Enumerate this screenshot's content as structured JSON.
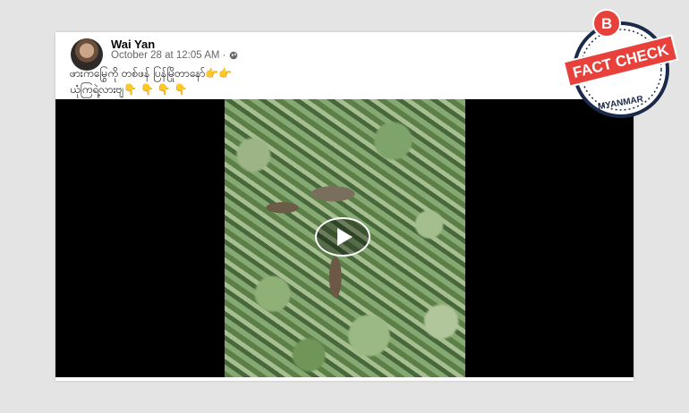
{
  "post": {
    "author": "Wai Yan",
    "timestamp": "October 28 at 12:05 AM ·",
    "text": "ဖားကမြွေကို တစ်ဖန်  ပြန်မြိုတာနော်👉👉\nယုံကြရဲ့လားဗျ👇 👇 👇 👇"
  },
  "badge": {
    "letter": "B",
    "label": "FACT CHECK",
    "sublabel": "MYANMAR",
    "colors": {
      "red": "#e8413c",
      "navy": "#1c2a4a"
    }
  },
  "icons": {
    "privacy": "globe-icon",
    "video": "play-icon"
  }
}
